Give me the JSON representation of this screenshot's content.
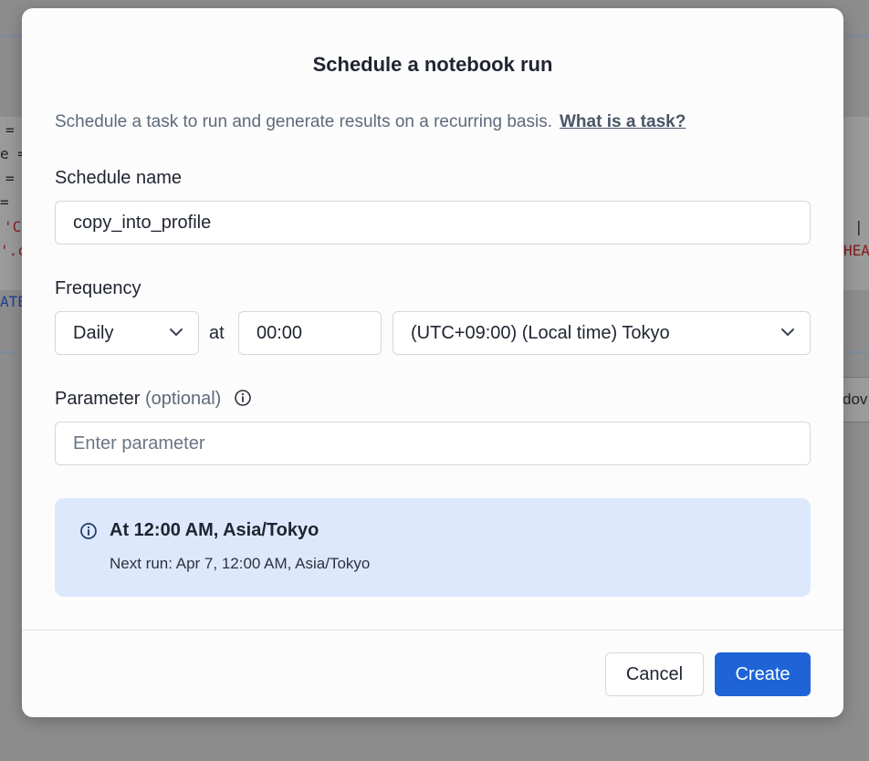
{
  "background": {
    "code_fragments": [
      "=",
      "e =",
      "=",
      "=",
      "'C",
      "'.c",
      "ATE",
      "|",
      "HEA"
    ],
    "side_button": "dov"
  },
  "modal": {
    "title": "Schedule a notebook run",
    "description": "Schedule a task to run and generate results on a recurring basis.",
    "help_link": "What is a task?",
    "schedule_name": {
      "label": "Schedule name",
      "value": "copy_into_profile"
    },
    "frequency": {
      "label": "Frequency",
      "interval": "Daily",
      "at_label": "at",
      "time": "00:00",
      "timezone": "(UTC+09:00) (Local time) Tokyo"
    },
    "parameter": {
      "label": "Parameter",
      "optional": "(optional)",
      "placeholder": "Enter parameter"
    },
    "summary": {
      "headline": "At 12:00 AM, Asia/Tokyo",
      "next_run": "Next run: Apr 7, 12:00 AM, Asia/Tokyo"
    },
    "buttons": {
      "cancel": "Cancel",
      "create": "Create"
    }
  },
  "colors": {
    "primary": "#1e64d6",
    "info_background": "#dde8fd",
    "overlay": "#8d8d8d"
  }
}
